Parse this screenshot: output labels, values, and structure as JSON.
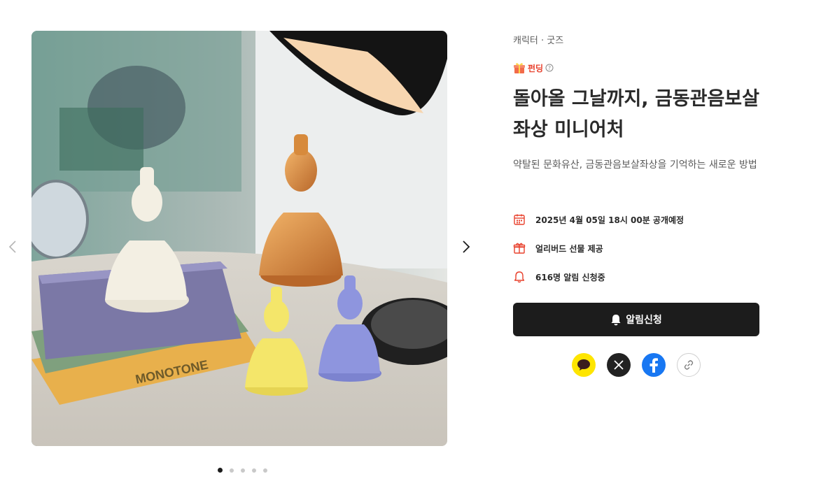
{
  "product": {
    "category": "캐릭터 · 굿즈",
    "funding_label": "펀딩",
    "title": "돌아올 그날까지, 금동관음보살좌상 미니어처",
    "subtitle": "약탈된 문화유산, 금동관음보살좌상을 기억하는 새로운 방법"
  },
  "meta": {
    "open_date": "2025년 4월 05일 18시 00분 공개예정",
    "gift": "얼리버드 선물 제공",
    "alarm_count": "616명 알림 신청중"
  },
  "cta": {
    "notify_label": "알림신청"
  },
  "gallery": {
    "image_description": "Photo of Buddha statue miniatures (white, gold, yellow, lavender) on books under a desk lamp",
    "slide_count": 5,
    "active_index": 0,
    "colors": {
      "white": "#f3efe3",
      "gold": "#d78a3c",
      "yellow": "#f4e66a",
      "lavender": "#8e95de"
    }
  },
  "share": [
    "kakao-icon",
    "x-icon",
    "facebook-icon",
    "link-icon"
  ],
  "colors": {
    "accent_red": "#e8402c",
    "button_dark": "#1c1c1c",
    "kakao": "#fee500",
    "facebook": "#1877f2"
  }
}
